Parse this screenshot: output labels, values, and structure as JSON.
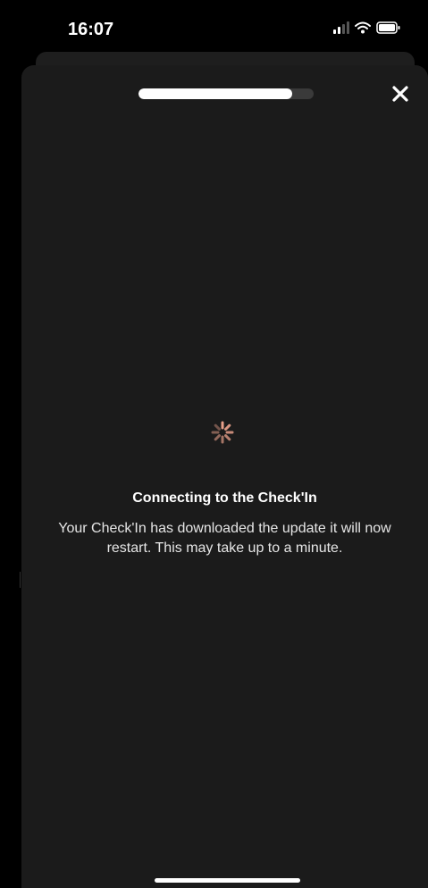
{
  "status_bar": {
    "time": "16:07",
    "icons": [
      "cellular-signal-icon",
      "wifi-icon",
      "battery-icon"
    ]
  },
  "sheet": {
    "progress": 0.88,
    "close_icon": "close-icon"
  },
  "loading": {
    "title": "Connecting to the Check'In",
    "description": "Your Check'In has downloaded the update it will now restart. This may take up to a minute."
  },
  "colors": {
    "background": "#1b1b1b",
    "spinner_accent": "#e8a08a",
    "text": "#ffffff"
  }
}
